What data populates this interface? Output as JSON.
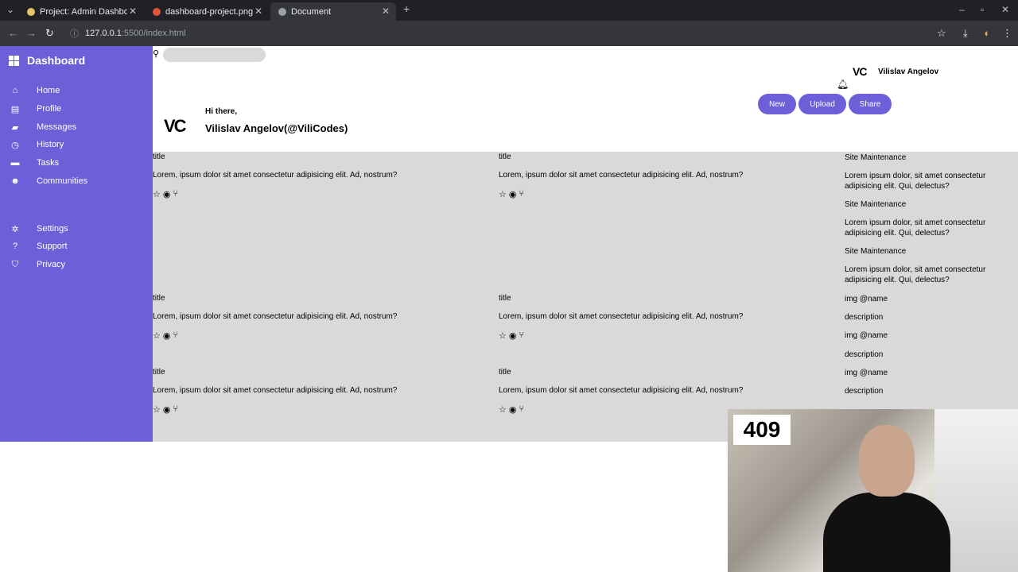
{
  "browser": {
    "tabs": [
      {
        "title": "Project: Admin Dashboard"
      },
      {
        "title": "dashboard-project.png (..."
      },
      {
        "title": "Document"
      }
    ],
    "url_host": "127.0.0.1",
    "url_path": ":5500/index.html"
  },
  "sidebar": {
    "brand": "Dashboard",
    "items": [
      {
        "label": "Home",
        "icon": "home-icon"
      },
      {
        "label": "Profile",
        "icon": "id-card-icon"
      },
      {
        "label": "Messages",
        "icon": "message-icon"
      },
      {
        "label": "History",
        "icon": "clock-icon"
      },
      {
        "label": "Tasks",
        "icon": "task-icon"
      },
      {
        "label": "Communities",
        "icon": "users-icon"
      },
      {
        "label": "Settings",
        "icon": "gear-icon"
      },
      {
        "label": "Support",
        "icon": "question-icon"
      },
      {
        "label": "Privacy",
        "icon": "shield-icon"
      }
    ]
  },
  "header": {
    "greeting": "Hi there,",
    "username": "Vilislav Angelov(@ViliCodes)",
    "logo_text": "VC",
    "top_name": "Vilislav Angelov",
    "buttons": {
      "new": "New",
      "upload": "Upload",
      "share": "Share"
    }
  },
  "cards": [
    {
      "title": "title",
      "desc": "Lorem, ipsum dolor sit amet consectetur adipisicing elit. Ad, nostrum?"
    },
    {
      "title": "title",
      "desc": "Lorem, ipsum dolor sit amet consectetur adipisicing elit. Ad, nostrum?"
    },
    {
      "title": "title",
      "desc": "Lorem, ipsum dolor sit amet consectetur adipisicing elit. Ad, nostrum?"
    },
    {
      "title": "title",
      "desc": "Lorem, ipsum dolor sit amet consectetur adipisicing elit. Ad, nostrum?"
    },
    {
      "title": "title",
      "desc": "Lorem, ipsum dolor sit amet consectetur adipisicing elit. Ad, nostrum?"
    },
    {
      "title": "title",
      "desc": "Lorem, ipsum dolor sit amet consectetur adipisicing elit. Ad, nostrum?"
    }
  ],
  "announcements": [
    {
      "title": "Site Maintenance",
      "desc": "Lorem ipsum dolor, sit amet consectetur adipisicing elit. Qui, delectus?"
    },
    {
      "title": "Site Maintenance",
      "desc": "Lorem ipsum dolor, sit amet consectetur adipisicing elit. Qui, delectus?"
    },
    {
      "title": "Site Maintenance",
      "desc": "Lorem ipsum dolor, sit amet consectetur adipisicing elit. Qui, delectus?"
    }
  ],
  "trending": [
    {
      "name": "img @name",
      "desc": "description"
    },
    {
      "name": "img @name",
      "desc": "description"
    },
    {
      "name": "img @name",
      "desc": "description"
    }
  ],
  "overlay": {
    "counter": "409"
  }
}
